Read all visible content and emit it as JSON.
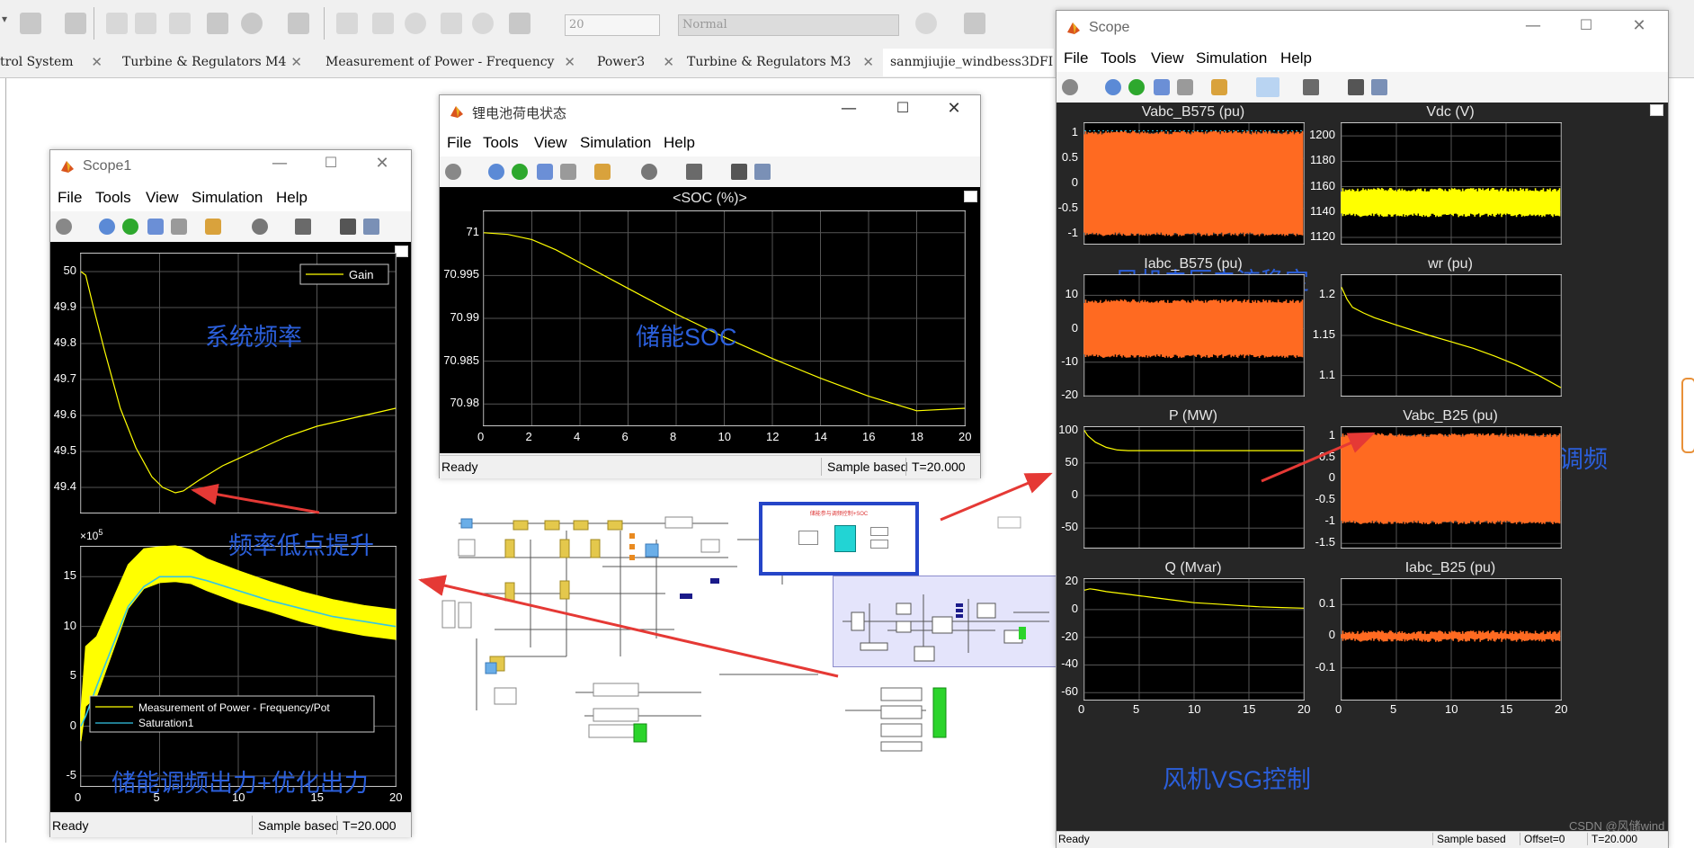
{
  "top_toolbar": {
    "sim_time_value": "20",
    "sim_mode_value": "Normal"
  },
  "tabs": [
    {
      "label": "trol System"
    },
    {
      "label": "Turbine & Regulators M4"
    },
    {
      "label": "Measurement of  Power - Frequency"
    },
    {
      "label": "Power3"
    },
    {
      "label": "Turbine & Regulators M3"
    },
    {
      "label": "sanmjiujie_windbess3DFIG"
    }
  ],
  "menu": {
    "file": "File",
    "tools": "Tools",
    "view": "View",
    "simulation": "Simulation",
    "help": "Help"
  },
  "scope1": {
    "title": "Scope1",
    "status": {
      "ready": "Ready",
      "mode": "Sample based",
      "time": "T=20.000"
    },
    "annotations": {
      "freq": "系统频率",
      "low": "频率低点提升",
      "power": "储能调频出力+优化出力"
    },
    "multiplier": "×10",
    "multiplier_exp": "5"
  },
  "soc": {
    "title": "锂电池荷电状态",
    "plot_title": "<SOC (%)>",
    "annotation": "储能SOC",
    "status": {
      "ready": "Ready",
      "mode": "Sample based",
      "time": "T=20.000"
    }
  },
  "scope": {
    "title": "Scope",
    "annotations": {
      "stable": "风机电压电流稳定",
      "speed": "风机释放转速参与调频",
      "vsg": "风机VSG控制"
    },
    "status": {
      "ready": "Ready",
      "mode": "Sample based",
      "offset": "Offset=0",
      "time": "T=20.000"
    }
  },
  "diagram": {
    "block_label": "储能参与调频控制+SOC"
  },
  "watermark": "CSDN @风储wind",
  "colors": {
    "plot_bg": "#000000",
    "yellow": "#ffff00",
    "orange": "#ff6a21",
    "cyan": "#33c6e6",
    "annotation": "#2b5fdb",
    "arrow": "#e53935"
  },
  "chart_data": [
    {
      "id": "scope1-top",
      "type": "line",
      "legend": [
        "Gain"
      ],
      "xlim": [
        0,
        20
      ],
      "ylim": [
        49.33,
        50.05
      ],
      "x_ticks": [
        "0",
        "5",
        "10",
        "15",
        "20"
      ],
      "y_ticks": [
        "50",
        "49.9",
        "49.8",
        "49.7",
        "49.6",
        "49.5",
        "49.4"
      ],
      "series": [
        {
          "name": "Gain",
          "x": [
            0,
            0.3,
            0.8,
            1.5,
            2.5,
            3.5,
            4.5,
            5.2,
            6,
            6.5,
            7.5,
            9,
            11,
            13,
            15,
            17,
            19,
            20
          ],
          "y": [
            50,
            49.99,
            49.9,
            49.78,
            49.62,
            49.51,
            49.43,
            49.4,
            49.385,
            49.39,
            49.42,
            49.46,
            49.5,
            49.54,
            49.57,
            49.59,
            49.61,
            49.62
          ]
        }
      ]
    },
    {
      "id": "scope1-bottom",
      "type": "area",
      "legend": [
        "Measurement of  Power - Frequency/Pot",
        "Saturation1"
      ],
      "xlim": [
        0,
        20
      ],
      "ylim": [
        -6,
        18
      ],
      "x_ticks": [
        "0",
        "5",
        "10",
        "15",
        "20"
      ],
      "y_ticks": [
        "15",
        "10",
        "5",
        "0",
        "-5"
      ],
      "series": [
        {
          "name": "Measurement of  Power - Frequency/Pot",
          "x": [
            0,
            0.3,
            1,
            2,
            3,
            4,
            5,
            6,
            7,
            8,
            10,
            12,
            14,
            16,
            18,
            20
          ],
          "y": [
            0,
            5,
            6,
            10,
            14,
            15.8,
            16.2,
            16.3,
            16,
            15.2,
            14,
            13,
            12,
            11.2,
            10.6,
            10.2
          ],
          "band": [
            1.5,
            3,
            3,
            2.6,
            2.2,
            2,
            1.8,
            1.8,
            1.7,
            1.6,
            1.6,
            1.5,
            1.5,
            1.5,
            1.5,
            1.5
          ]
        },
        {
          "name": "Saturation1",
          "x": [
            0,
            0.3,
            1,
            2,
            3,
            4,
            5,
            6,
            7,
            8,
            10,
            12,
            14,
            16,
            18,
            20
          ],
          "y": [
            0,
            1,
            4,
            8,
            12,
            14,
            15,
            15,
            15,
            14.6,
            13.6,
            12.6,
            11.8,
            11,
            10.5,
            10
          ]
        }
      ]
    },
    {
      "id": "soc",
      "type": "line",
      "xlim": [
        0,
        20
      ],
      "ylim": [
        70.9775,
        71.0025
      ],
      "x_ticks": [
        "0",
        "2",
        "4",
        "6",
        "8",
        "10",
        "12",
        "14",
        "16",
        "18",
        "20"
      ],
      "y_ticks": [
        "71",
        "70.995",
        "70.99",
        "70.985",
        "70.98"
      ],
      "series": [
        {
          "name": "SOC",
          "x": [
            0,
            1,
            2,
            3,
            4,
            6,
            8,
            10,
            12,
            14,
            16,
            18,
            20
          ],
          "y": [
            71,
            70.9998,
            70.9992,
            70.998,
            70.9965,
            70.9935,
            70.9905,
            70.9878,
            70.9853,
            70.983,
            70.9809,
            70.9792,
            70.9795
          ]
        }
      ]
    },
    {
      "id": "Vabc_B575",
      "title": "Vabc_B575 (pu)",
      "type": "area",
      "xlim": [
        0,
        20
      ],
      "ylim": [
        -1.2,
        1.2
      ],
      "y_ticks": [
        "1",
        "0.5",
        "0",
        "-0.5",
        "-1"
      ],
      "series": [
        {
          "name": "Vabc_B575",
          "y_band": [
            -1,
            1
          ],
          "color": "orange"
        }
      ]
    },
    {
      "id": "Vdc",
      "title": "Vdc (V)",
      "type": "area",
      "xlim": [
        0,
        20
      ],
      "ylim": [
        1115,
        1210
      ],
      "y_ticks": [
        "1200",
        "1180",
        "1160",
        "1140",
        "1120"
      ],
      "series": [
        {
          "name": "Vdc",
          "y_band": [
            1138,
            1157
          ],
          "color": "yellow"
        }
      ]
    },
    {
      "id": "Iabc_B575",
      "title": "Iabc_B575 (pu)",
      "type": "area",
      "xlim": [
        0,
        20
      ],
      "ylim": [
        -20,
        16
      ],
      "y_ticks": [
        "10",
        "0",
        "-10",
        "-20"
      ],
      "series": [
        {
          "name": "Iabc_B575",
          "y_band": [
            -8,
            8
          ],
          "color": "orange"
        }
      ]
    },
    {
      "id": "wr",
      "title": "wr (pu)",
      "type": "line",
      "xlim": [
        0,
        20
      ],
      "ylim": [
        1.075,
        1.225
      ],
      "y_ticks": [
        "1.2",
        "1.15",
        "1.1"
      ],
      "series": [
        {
          "name": "wr",
          "x": [
            0,
            0.5,
            1,
            2,
            3,
            5,
            8,
            10,
            12,
            14,
            16,
            18,
            20
          ],
          "y": [
            1.21,
            1.195,
            1.185,
            1.178,
            1.172,
            1.163,
            1.15,
            1.142,
            1.134,
            1.124,
            1.113,
            1.1,
            1.085
          ]
        }
      ]
    },
    {
      "id": "P",
      "title": "P (MW)",
      "type": "line",
      "xlim": [
        0,
        20
      ],
      "ylim": [
        -80,
        105
      ],
      "y_ticks": [
        "100",
        "50",
        "0",
        "-50"
      ],
      "series": [
        {
          "name": "P",
          "x": [
            0,
            0.3,
            1,
            2,
            3,
            4,
            6,
            10,
            15,
            20
          ],
          "y": [
            100,
            92,
            82,
            74,
            70,
            69,
            69,
            69,
            69,
            69
          ]
        }
      ]
    },
    {
      "id": "Vabc_B25",
      "title": "Vabc_B25 (pu)",
      "type": "area",
      "xlim": [
        0,
        20
      ],
      "ylim": [
        -1.6,
        1.2
      ],
      "y_ticks": [
        "1",
        "0.5",
        "0",
        "-0.5",
        "-1",
        "-1.5"
      ],
      "series": [
        {
          "name": "Vabc_B25",
          "y_band": [
            -1,
            1
          ],
          "color": "orange"
        }
      ]
    },
    {
      "id": "Q",
      "title": "Q (Mvar)",
      "type": "line",
      "xlim": [
        0,
        20
      ],
      "ylim": [
        -65,
        22
      ],
      "x_ticks": [
        "0",
        "5",
        "10",
        "15",
        "20"
      ],
      "y_ticks": [
        "20",
        "0",
        "-20",
        "-40",
        "-60"
      ],
      "series": [
        {
          "name": "Q",
          "x": [
            0,
            0.5,
            1,
            2,
            4,
            6,
            8,
            10,
            12,
            14,
            16,
            18,
            20
          ],
          "y": [
            14,
            15,
            14.5,
            13,
            11,
            9,
            7,
            5,
            4,
            3,
            2,
            1.5,
            1
          ]
        }
      ]
    },
    {
      "id": "Iabc_B25",
      "title": "Iabc_B25 (pu)",
      "type": "area",
      "xlim": [
        0,
        20
      ],
      "ylim": [
        -0.2,
        0.18
      ],
      "x_ticks": [
        "0",
        "5",
        "10",
        "15",
        "20"
      ],
      "y_ticks": [
        "0.1",
        "0",
        "-0.1"
      ],
      "series": [
        {
          "name": "Iabc_B25",
          "y_band": [
            -0.01,
            0.01
          ],
          "color": "orange"
        }
      ]
    }
  ]
}
